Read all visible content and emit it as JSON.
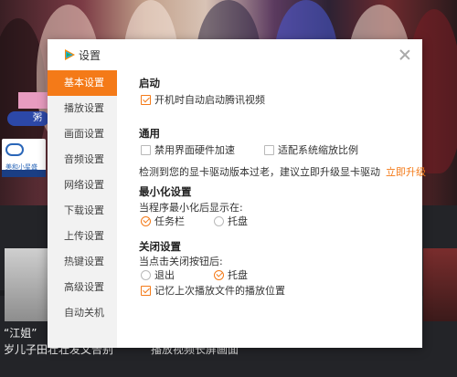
{
  "background": {
    "badge_text": "美和小星盛",
    "pill_text": "粥",
    "caption_line1": "“江姐”",
    "caption_line2": "岁儿子田壮壮发文告别",
    "caption_line3": "播放视频长屏画面"
  },
  "dialog": {
    "title": "设置",
    "sidebar": [
      {
        "label": "基本设置",
        "active": true
      },
      {
        "label": "播放设置"
      },
      {
        "label": "画面设置"
      },
      {
        "label": "音频设置"
      },
      {
        "label": "网络设置"
      },
      {
        "label": "下载设置"
      },
      {
        "label": "上传设置"
      },
      {
        "label": "热键设置"
      },
      {
        "label": "高级设置"
      },
      {
        "label": "自动关机"
      }
    ],
    "startup": {
      "title": "启动",
      "auto_start_label": "开机时自动启动腾讯视频",
      "auto_start_checked": true
    },
    "general": {
      "title": "通用",
      "hw_accel_label": "禁用界面硬件加速",
      "hw_accel_checked": false,
      "scale_label": "适配系统缩放比例",
      "scale_checked": false,
      "driver_notice": "检测到您的显卡驱动版本过老，建议立即升级显卡驱动",
      "upgrade_link": "立即升级"
    },
    "minimize": {
      "title": "最小化设置",
      "prompt": "当程序最小化后显示在:",
      "options": [
        "任务栏",
        "托盘"
      ],
      "selected": "任务栏"
    },
    "close": {
      "title": "关闭设置",
      "prompt": "当点击关闭按钮后:",
      "options": [
        "退出",
        "托盘"
      ],
      "selected": "托盘",
      "remember_label": "记忆上次播放文件的播放位置",
      "remember_checked": true
    }
  },
  "colors": {
    "accent": "#f47a18",
    "sidebar_bg": "#f2f2f2",
    "logo_orange": "#ff8a00",
    "logo_blue": "#27a9e1",
    "logo_green": "#1fb35b"
  }
}
